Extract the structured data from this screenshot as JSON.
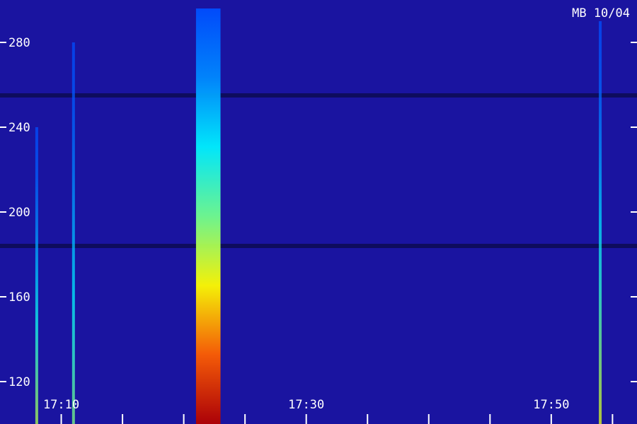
{
  "chart_data": {
    "type": "heatmap",
    "title": "MB 10/04",
    "xlabel": "",
    "ylabel": "",
    "colormap": "jet",
    "background_color": "#1a14a0",
    "xlim": [
      "17:05",
      "17:57"
    ],
    "ylim": [
      100,
      300
    ],
    "x_ticks": [
      "17:10",
      "17:30",
      "17:50"
    ],
    "y_ticks": [
      120,
      160,
      200,
      240,
      280
    ],
    "grid": false,
    "features": [
      {
        "kind": "broadband-burst",
        "x_start": "17:21",
        "x_end": "17:23",
        "y_start": 100,
        "y_end": 296,
        "peak_intensity": 0.95,
        "peak_at_y": 110
      },
      {
        "kind": "narrow-band-streak",
        "x": "17:08",
        "y_start": 100,
        "y_end": 240,
        "peak_intensity": 0.55
      },
      {
        "kind": "narrow-band-streak",
        "x": "17:11",
        "y_start": 100,
        "y_end": 280,
        "peak_intensity": 0.5
      },
      {
        "kind": "narrow-band-streak",
        "x": "17:54",
        "y_start": 100,
        "y_end": 290,
        "peak_intensity": 0.6
      }
    ],
    "horizontal_dark_bands_y": [
      255,
      184
    ]
  }
}
